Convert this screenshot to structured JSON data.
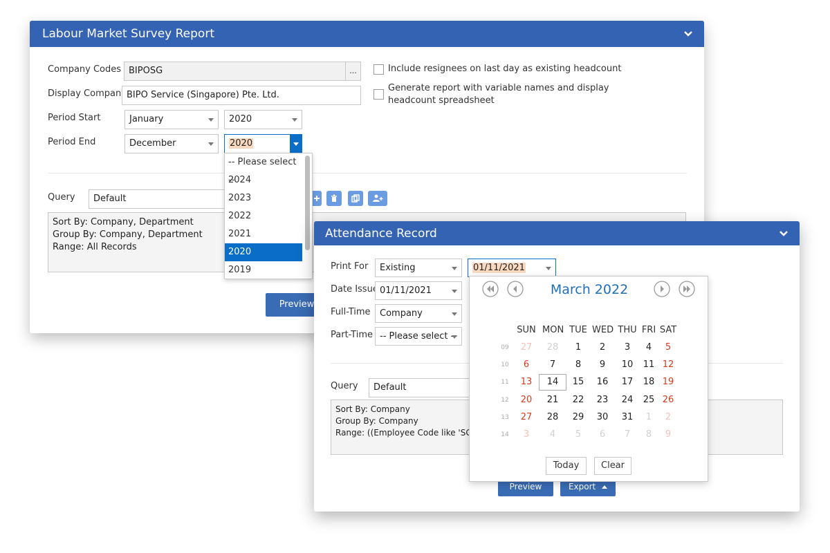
{
  "labour": {
    "title": "Labour Market Survey Report",
    "company_codes_label": "Company Codes",
    "company_codes_value": "BIPOSG",
    "ellipsis": "...",
    "display_company_label": "Display Company",
    "display_company_value": "BIPO Service (Singapore) Pte. Ltd.",
    "period_start_label": "Period Start",
    "period_start_month": "January",
    "period_start_year": "2020",
    "period_end_label": "Period End",
    "period_end_month": "December",
    "period_end_year": "2020",
    "include_resignees": "Include resignees on last day as existing headcount",
    "generate_report": "Generate report with variable names and display headcount spreadsheet",
    "query_label": "Query",
    "query_value": "Default",
    "query_text": [
      "Sort By: Company, Department",
      "Group By: Company, Department",
      "Range: All Records"
    ],
    "preview": "Preview",
    "year_options": [
      "-- Please select --",
      "2024",
      "2023",
      "2022",
      "2021",
      "2020",
      "2019"
    ],
    "selected_year": "2020"
  },
  "attendance": {
    "title": "Attendance Record",
    "print_for_label": "Print For",
    "print_for_value": "Existing",
    "print_for_date": "01/11/2021",
    "date_issue_label": "Date Issue",
    "date_issue_value": "01/11/2021",
    "full_time_label": "Full-Time",
    "full_time_value": "Company",
    "part_time_label": "Part-Time",
    "part_time_value": "-- Please select --",
    "query_label": "Query",
    "query_value": "Default",
    "query_text": [
      "Sort By: Company",
      "Group By: Company",
      "Range: ((Employee Code like 'SG%'"
    ],
    "preview": "Preview",
    "export": "Export"
  },
  "calendar": {
    "month_title": "March 2022",
    "weekdays": [
      "SUN",
      "MON",
      "TUE",
      "WED",
      "THU",
      "FRI",
      "SAT"
    ],
    "weeks": [
      {
        "wk": "09",
        "days": [
          "27",
          "28",
          "1",
          "2",
          "3",
          "4",
          "5"
        ]
      },
      {
        "wk": "10",
        "days": [
          "6",
          "7",
          "8",
          "9",
          "10",
          "11",
          "12"
        ]
      },
      {
        "wk": "11",
        "days": [
          "13",
          "14",
          "15",
          "16",
          "17",
          "18",
          "19"
        ]
      },
      {
        "wk": "12",
        "days": [
          "20",
          "21",
          "22",
          "23",
          "24",
          "25",
          "26"
        ]
      },
      {
        "wk": "13",
        "days": [
          "27",
          "28",
          "29",
          "30",
          "31",
          "1",
          "2"
        ]
      },
      {
        "wk": "14",
        "days": [
          "3",
          "4",
          "5",
          "6",
          "7",
          "8",
          "9"
        ]
      }
    ],
    "today_day": "14",
    "today_button": "Today",
    "clear_button": "Clear"
  },
  "colors": {
    "header": "#3563b4",
    "button": "#3a6cb5",
    "selected": "#0a6ec9",
    "weekend": "#d9391c",
    "muted": "#d0d0d0",
    "muted_weekend": "#f3c2b8"
  }
}
